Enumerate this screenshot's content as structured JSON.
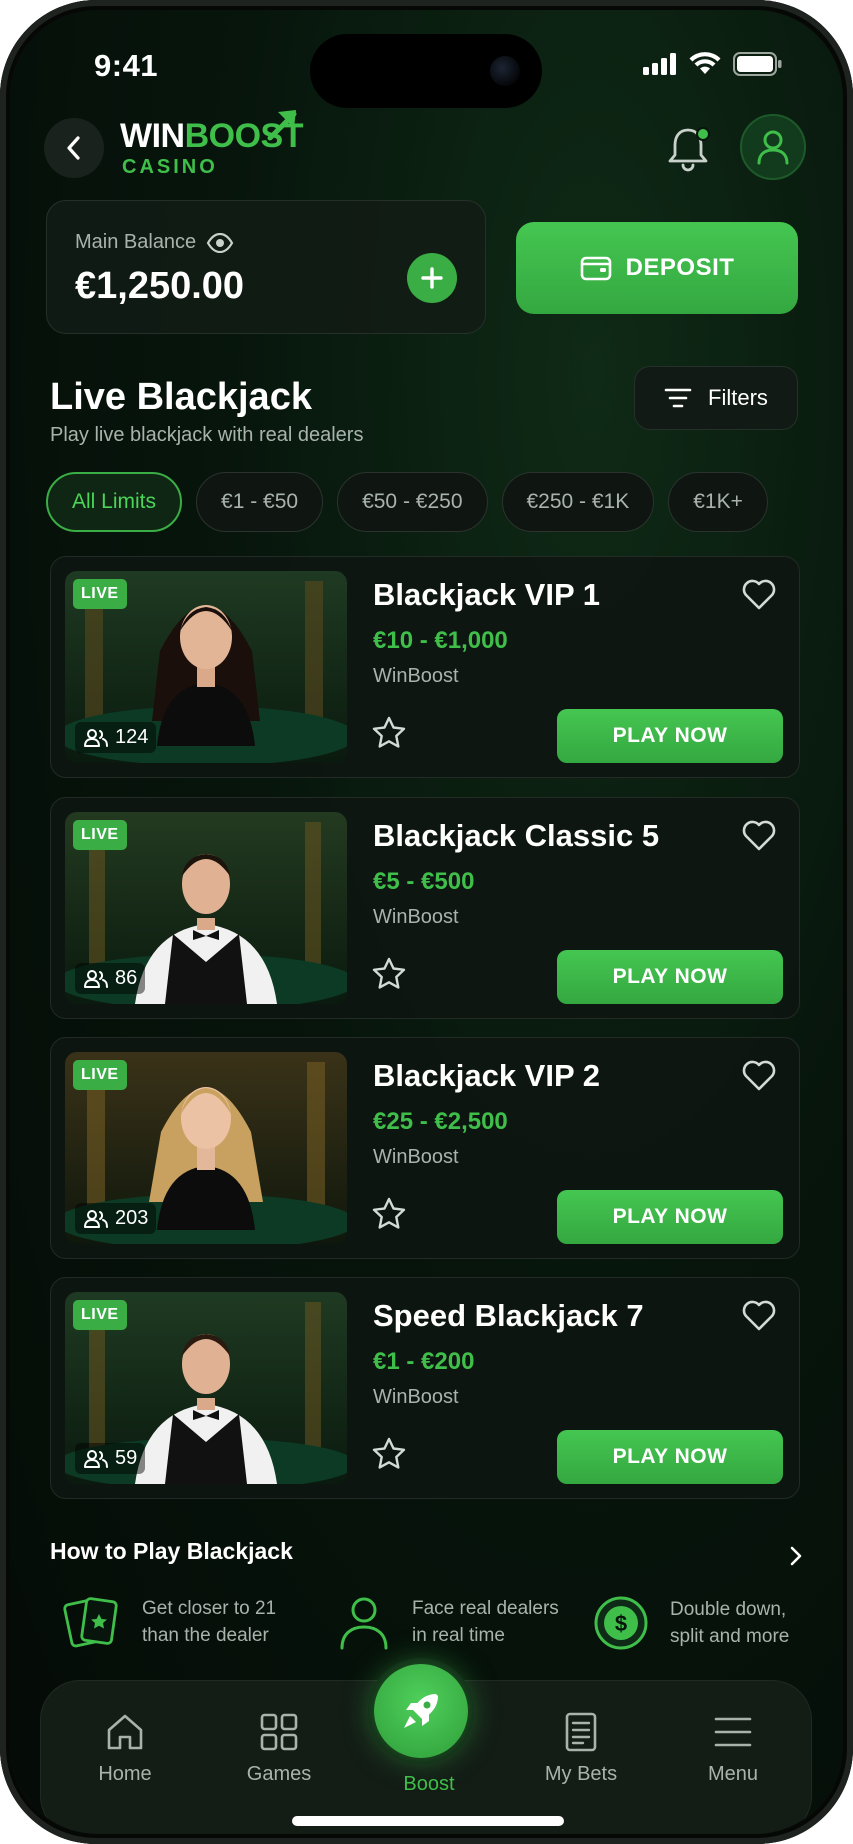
{
  "status_bar": {
    "time": "9:41"
  },
  "header": {
    "logo_win": "WIN",
    "logo_boost": "BOOST",
    "logo_sub": "CASINO"
  },
  "balance": {
    "label": "Main Balance",
    "value": "€1,250.00",
    "deposit_label": "DEPOSIT"
  },
  "section": {
    "title": "Live Blackjack",
    "subtitle": "Play live blackjack with real dealers",
    "filters_label": "Filters"
  },
  "chips": [
    {
      "label": "All Limits",
      "active": true
    },
    {
      "label": "€1 - €50",
      "active": false
    },
    {
      "label": "€50 - €250",
      "active": false
    },
    {
      "label": "€250 - €1K",
      "active": false
    },
    {
      "label": "€1K+",
      "active": false
    }
  ],
  "games": [
    {
      "title": "Blackjack VIP 1",
      "limits": "€10 - €1,000",
      "provider": "WinBoost",
      "viewers": "124",
      "badge": "LIVE",
      "play_label": "PLAY NOW",
      "dealer": "female-dark-hair"
    },
    {
      "title": "Blackjack Classic 5",
      "limits": "€5 - €500",
      "provider": "WinBoost",
      "viewers": "86",
      "badge": "LIVE",
      "play_label": "PLAY NOW",
      "dealer": "male-dark-hair"
    },
    {
      "title": "Blackjack VIP 2",
      "limits": "€25 - €2,500",
      "provider": "WinBoost",
      "viewers": "203",
      "badge": "LIVE",
      "play_label": "PLAY NOW",
      "dealer": "female-blonde-hair"
    },
    {
      "title": "Speed Blackjack 7",
      "limits": "€1 - €200",
      "provider": "WinBoost",
      "viewers": "59",
      "badge": "LIVE",
      "play_label": "PLAY NOW",
      "dealer": "male-dark-hair"
    }
  ],
  "how_to_play": {
    "title": "How to Play Blackjack",
    "tips": [
      {
        "icon": "cards-icon",
        "line1": "Get closer to 21",
        "line2": "than the dealer"
      },
      {
        "icon": "person-icon",
        "line1": "Face real dealers",
        "line2": "in real time"
      },
      {
        "icon": "dollar-coin-icon",
        "line1": "Double down,",
        "line2": "split and more"
      }
    ]
  },
  "nav": {
    "home": "Home",
    "games": "Games",
    "boost": "Boost",
    "my_bets": "My Bets",
    "menu": "Menu"
  },
  "colors": {
    "accent": "#3fbf4a",
    "background": "#07150c",
    "text_muted": "#a9b3ac"
  }
}
